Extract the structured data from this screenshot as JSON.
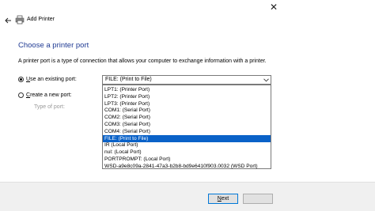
{
  "window": {
    "title": "Add Printer"
  },
  "icons": {
    "back": "back-arrow-icon",
    "printer": "printer-icon",
    "close": "close-icon",
    "dropdown": "chevron-down-icon"
  },
  "page": {
    "heading": "Choose a printer port",
    "description": "A printer port is a type of connection that allows your computer to exchange information with a printer."
  },
  "options": {
    "use_existing": {
      "label_prefix": "",
      "label_underline": "U",
      "label_rest": "se an existing port:",
      "checked": true
    },
    "create_new": {
      "label_underline": "C",
      "label_rest": "reate a new port:",
      "checked": false
    },
    "type_of_port_label": "Type of port:"
  },
  "combo": {
    "selected": "FILE: (Print to File)"
  },
  "ports": [
    "LPT1: (Printer Port)",
    "LPT2: (Printer Port)",
    "LPT3: (Printer Port)",
    "COM1: (Serial Port)",
    "COM2: (Serial Port)",
    "COM3: (Serial Port)",
    "COM4: (Serial Port)",
    "FILE: (Print to File)",
    "IR (Local Port)",
    "nul: (Local Port)",
    "PORTPROMPT: (Local Port)",
    "WSD-a9e8c09a-2841-47a3-b2b8-bd9e6410f903.0032 (WSD Port)"
  ],
  "selected_port_index": 7,
  "buttons": {
    "next_underline": "N",
    "next_rest": "ext",
    "cancel": ""
  },
  "colors": {
    "heading": "#1f3a93",
    "selection": "#0a62c8",
    "next_border": "#0078d7"
  }
}
